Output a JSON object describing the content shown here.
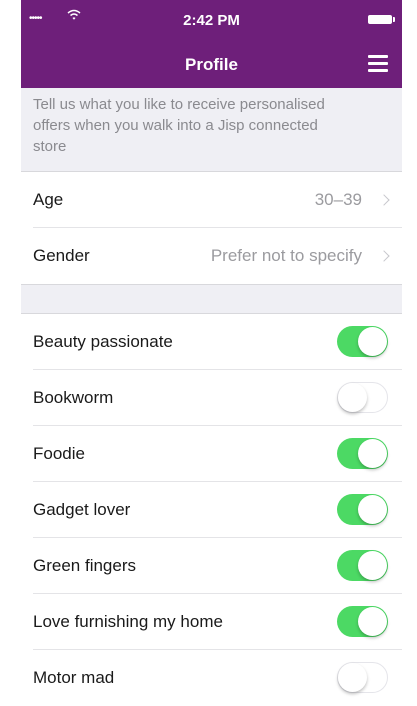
{
  "status_bar": {
    "signal": "•••••",
    "time": "2:42 PM",
    "icons": [
      "wifi-icon",
      "battery-icon"
    ]
  },
  "header": {
    "title": "Profile",
    "menu_icon": "hamburger-menu-icon",
    "background": "#6e1f7a"
  },
  "intro": {
    "text": "Tell us what you like to receive personalised offers when you walk into a Jisp connected store"
  },
  "details": [
    {
      "label": "Age",
      "value": "30–39"
    },
    {
      "label": "Gender",
      "value": "Prefer not to specify"
    }
  ],
  "interests": [
    {
      "label": "Beauty passionate",
      "on": true
    },
    {
      "label": "Bookworm",
      "on": false
    },
    {
      "label": "Foodie",
      "on": true
    },
    {
      "label": "Gadget lover",
      "on": true
    },
    {
      "label": "Green fingers",
      "on": true
    },
    {
      "label": "Love furnishing my home",
      "on": true
    },
    {
      "label": "Motor mad",
      "on": false
    }
  ],
  "colors": {
    "toggle_on": "#4cd964",
    "accent": "#6e1f7a"
  }
}
